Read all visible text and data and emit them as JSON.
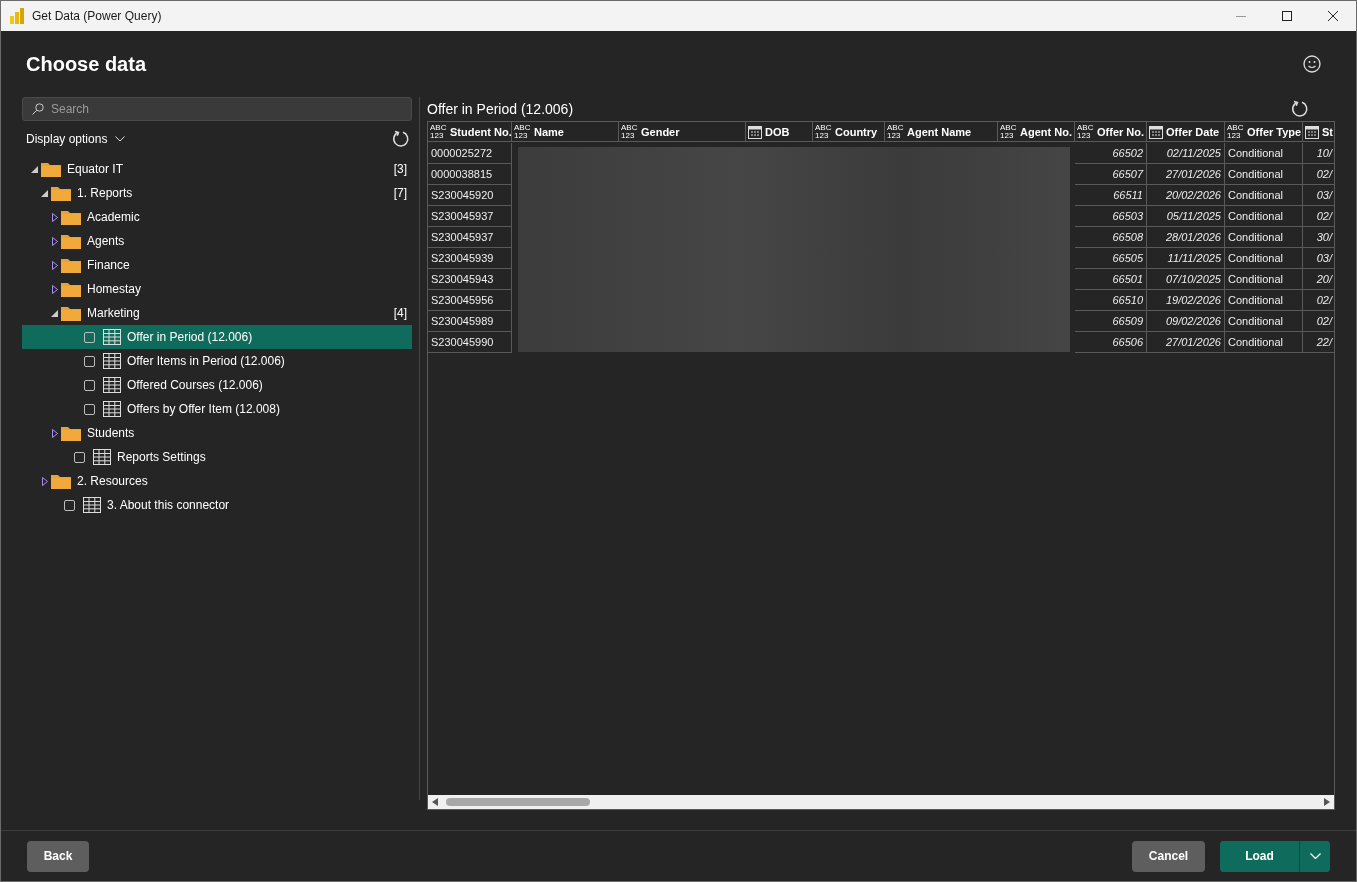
{
  "window": {
    "title": "Get Data (Power Query)"
  },
  "heading": "Choose data",
  "search": {
    "placeholder": "Search"
  },
  "display_options": "Display options",
  "tree": [
    {
      "kind": "folder",
      "label": "Equator IT",
      "count": "[3]",
      "expanded": true,
      "children": [
        {
          "kind": "folder",
          "label": "1. Reports",
          "count": "[7]",
          "expanded": true,
          "children": [
            {
              "kind": "folder",
              "label": "Academic",
              "expanded": false
            },
            {
              "kind": "folder",
              "label": "Agents",
              "expanded": false
            },
            {
              "kind": "folder",
              "label": "Finance",
              "expanded": false
            },
            {
              "kind": "folder",
              "label": "Homestay",
              "expanded": false
            },
            {
              "kind": "folder",
              "label": "Marketing",
              "count": "[4]",
              "expanded": true,
              "children": [
                {
                  "kind": "table",
                  "label": "Offer in Period (12.006)",
                  "checked": false,
                  "selected": true
                },
                {
                  "kind": "table",
                  "label": "Offer Items in Period (12.006)",
                  "checked": false,
                  "selected": false
                },
                {
                  "kind": "table",
                  "label": "Offered Courses (12.006)",
                  "checked": false,
                  "selected": false
                },
                {
                  "kind": "table",
                  "label": "Offers by Offer Item (12.008)",
                  "checked": false,
                  "selected": false
                }
              ]
            },
            {
              "kind": "folder",
              "label": "Students",
              "expanded": false
            },
            {
              "kind": "table",
              "label": "Reports Settings",
              "checked": false,
              "selected": false
            }
          ]
        },
        {
          "kind": "folder",
          "label": "2. Resources",
          "expanded": false
        },
        {
          "kind": "table",
          "label": "3. About this connector",
          "checked": false,
          "selected": false
        }
      ]
    }
  ],
  "preview": {
    "title": "Offer in Period (12.006)",
    "columns": [
      {
        "label": "Student No.",
        "type_label": "ABC 123",
        "kind": "text",
        "redacted": false
      },
      {
        "label": "Name",
        "type_label": "ABC 123",
        "kind": "text",
        "redacted": true
      },
      {
        "label": "Gender",
        "type_label": "ABC 123",
        "kind": "text",
        "redacted": true
      },
      {
        "label": "DOB",
        "kind": "date",
        "redacted": true
      },
      {
        "label": "Country",
        "type_label": "ABC 123",
        "kind": "text",
        "redacted": true
      },
      {
        "label": "Agent Name",
        "type_label": "ABC 123",
        "kind": "text",
        "redacted": true
      },
      {
        "label": "Agent No.",
        "type_label": "ABC 123",
        "kind": "number",
        "redacted": true
      },
      {
        "label": "Offer No.",
        "type_label": "ABC 123",
        "kind": "number",
        "redacted": false
      },
      {
        "label": "Offer Date",
        "kind": "date",
        "redacted": false
      },
      {
        "label": "Offer Type",
        "type_label": "ABC 123",
        "kind": "text",
        "redacted": false
      },
      {
        "label": "St",
        "kind": "date",
        "redacted": false
      }
    ],
    "rows": [
      {
        "cells": [
          "0000025272",
          "66502",
          "02/11/2025",
          "Conditional",
          "10/"
        ]
      },
      {
        "cells": [
          "0000038815",
          "66507",
          "27/01/2026",
          "Conditional",
          "02/"
        ]
      },
      {
        "cells": [
          "S230045920",
          "66511",
          "20/02/2026",
          "Conditional",
          "03/"
        ]
      },
      {
        "cells": [
          "S230045937",
          "66503",
          "05/11/2025",
          "Conditional",
          "02/"
        ]
      },
      {
        "cells": [
          "S230045937",
          "66508",
          "28/01/2026",
          "Conditional",
          "30/"
        ]
      },
      {
        "cells": [
          "S230045939",
          "66505",
          "11/11/2025",
          "Conditional",
          "03/"
        ]
      },
      {
        "cells": [
          "S230045943",
          "66501",
          "07/10/2025",
          "Conditional",
          "20/"
        ]
      },
      {
        "cells": [
          "S230045956",
          "66510",
          "19/02/2026",
          "Conditional",
          "02/"
        ]
      },
      {
        "cells": [
          "S230045989",
          "66509",
          "09/02/2026",
          "Conditional",
          "02/"
        ]
      },
      {
        "cells": [
          "S230045990",
          "66506",
          "27/01/2026",
          "Conditional",
          "22/"
        ]
      }
    ]
  },
  "buttons": {
    "back": "Back",
    "cancel": "Cancel",
    "load": "Load"
  }
}
